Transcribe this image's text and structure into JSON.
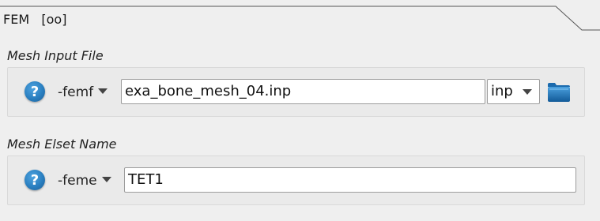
{
  "tab": {
    "title": "FEM   [oo]"
  },
  "mesh_input_file": {
    "section_title": "Mesh Input File",
    "flag_label": "-femf",
    "value": "exa_bone_mesh_04.inp",
    "format_selected": "inp",
    "help_label": "?"
  },
  "mesh_elset_name": {
    "section_title": "Mesh Elset Name",
    "flag_label": "-feme",
    "value": "TET1",
    "help_label": "?"
  },
  "colors": {
    "background": "#efefef",
    "help_blue": "#2a7fc0",
    "folder_blue": "#1f77b4"
  }
}
